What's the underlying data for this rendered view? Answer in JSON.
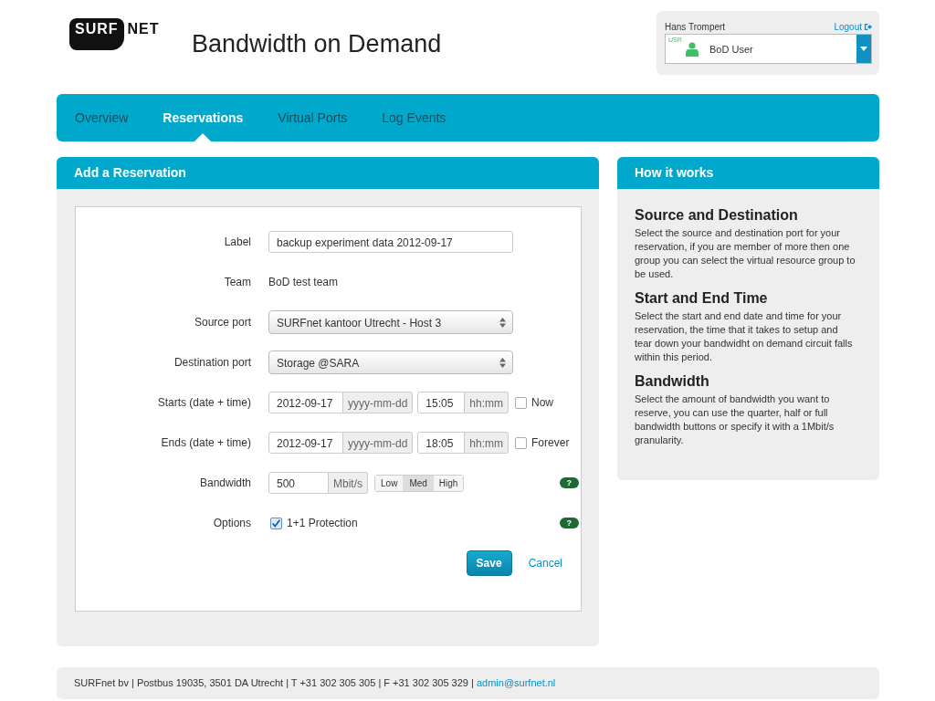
{
  "logo": {
    "badge": "SURF",
    "text": "NET"
  },
  "title": "Bandwidth on Demand",
  "user": {
    "name": "Hans Trompert",
    "logout": "Logout",
    "role_badge": "USR",
    "role": "BoD User"
  },
  "tabs": [
    {
      "label": "Overview",
      "selected": false
    },
    {
      "label": "Reservations",
      "selected": true
    },
    {
      "label": "Virtual Ports",
      "selected": false
    },
    {
      "label": "Log Events",
      "selected": false
    }
  ],
  "form": {
    "title": "Add a Reservation",
    "rows": [
      {
        "kind": "text",
        "label": "Label",
        "value": "backup experiment data 2012-09-17"
      },
      {
        "kind": "static",
        "label": "Team",
        "value": "BoD test team"
      },
      {
        "kind": "select",
        "label": "Source port",
        "value": "SURFnet kantoor Utrecht - Host 3"
      },
      {
        "kind": "select",
        "label": "Destination port",
        "value": "Storage @SARA"
      },
      {
        "kind": "datetime",
        "label": "Starts (date + time)",
        "date": "2012-09-17",
        "date_addon": "yyyy-mm-dd",
        "time": "15:05",
        "time_addon": "hh:mm",
        "check_label": "Now",
        "checked": false
      },
      {
        "kind": "datetime",
        "label": "Ends (date + time)",
        "date": "2012-09-17",
        "date_addon": "yyyy-mm-dd",
        "time": "18:05",
        "time_addon": "hh:mm",
        "check_label": "Forever",
        "checked": false
      },
      {
        "kind": "bandwidth",
        "label": "Bandwidth",
        "value": "500",
        "addon": "Mbit/s",
        "presets": [
          {
            "label": "Low",
            "selected": false
          },
          {
            "label": "Med",
            "selected": true
          },
          {
            "label": "High",
            "selected": false
          }
        ],
        "help": "?"
      },
      {
        "kind": "options",
        "label": "Options",
        "check_label": "1+1 Protection",
        "checked": true,
        "help": "?"
      }
    ],
    "save": "Save",
    "cancel": "Cancel"
  },
  "help": {
    "title": "How it works",
    "sections": [
      {
        "heading": "Source and Destination",
        "text": "Select the source and destination port for your reservation, if you are member of more then one group you can select the virtual resource group to be used."
      },
      {
        "heading": "Start and End Time",
        "text": "Select the start and end date and time for your reservation, the time that it takes to setup and tear down your bandwidht on demand circuit falls within this period."
      },
      {
        "heading": "Bandwidth",
        "text": "Select the amount of bandwidth you want to reserve, you can use the quarter, half or full bandwidth buttons or specify it with a 1Mbit/s granularity."
      }
    ]
  },
  "footer": {
    "text": "SURFnet bv | Postbus 19035, 3501 DA Utrecht | T +31 302 305 305 | F +31 302 305 329 | ",
    "email": "admin@surfnet.nl"
  }
}
